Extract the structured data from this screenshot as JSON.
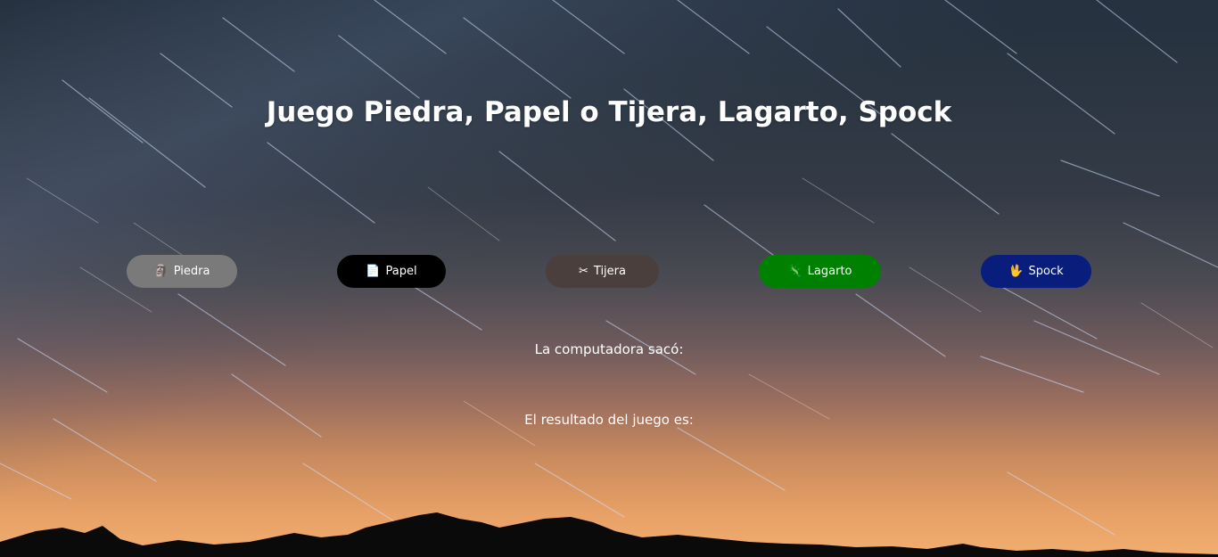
{
  "page": {
    "title": "Juego Piedra, Papel o Tijera, Lagarto, Spock"
  },
  "choices": [
    {
      "label": "Piedra",
      "icon": "rock-icon",
      "glyph": "🗿",
      "color": "#7a7a7a"
    },
    {
      "label": "Papel",
      "icon": "paper-icon",
      "glyph": "📄",
      "color": "#000000"
    },
    {
      "label": "Tijera",
      "icon": "scissors-icon",
      "glyph": "✂",
      "color": "#4a3f3d"
    },
    {
      "label": "Lagarto",
      "icon": "lizard-icon",
      "glyph": "🦎",
      "color": "#008000"
    },
    {
      "label": "Spock",
      "icon": "spock-icon",
      "glyph": "🖖",
      "color": "#081d7c"
    }
  ],
  "status": {
    "computer_label": "La computadora sacó:",
    "result_label": "El resultado del juego es:"
  }
}
